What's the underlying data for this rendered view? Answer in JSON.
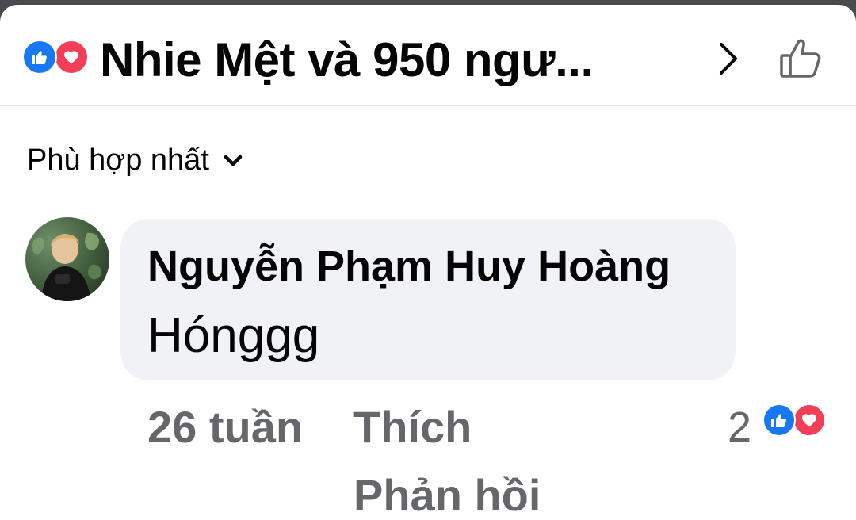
{
  "header": {
    "title": "Nhie Mệt và 950 ngư...",
    "reaction_icons": [
      "like-reaction-icon",
      "love-reaction-icon"
    ],
    "next_icon": "chevron-right-icon",
    "like_button_icon": "thumbs-up-outline-icon"
  },
  "sort": {
    "label": "Phù hợp nhất",
    "icon": "chevron-down-icon"
  },
  "comment": {
    "author": "Nguyễn Phạm Huy Hoàng",
    "text": "Hónggg",
    "time": "26 tuần",
    "like_label": "Thích",
    "reply_label": "Phản hồi",
    "reaction_count": "2",
    "reaction_icons": [
      "like-reaction-icon",
      "love-reaction-icon"
    ]
  },
  "colors": {
    "like_blue": "#1877f2",
    "love_red": "#f33e58",
    "bubble_bg": "#f0f2f5",
    "secondary_text": "#65676b",
    "primary_text": "#050505"
  }
}
